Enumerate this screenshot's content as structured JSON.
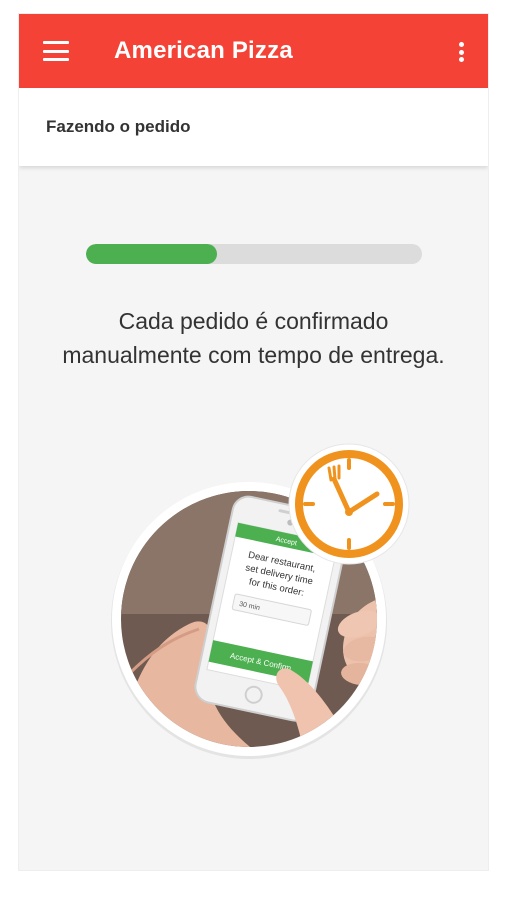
{
  "app_bar": {
    "title": "American Pizza",
    "menu_icon": "hamburger-menu-icon",
    "more_icon": "more-vertical-icon",
    "color": "#f44336"
  },
  "subheader": {
    "title": "Fazendo o pedido"
  },
  "progress": {
    "value_fraction": 0.39,
    "track_color": "#dcdcdc",
    "fill_color": "#4caf50"
  },
  "message": {
    "line1": "Cada pedido é confirmado",
    "line2": "manualmente com tempo de entrega."
  },
  "illustration": {
    "phone_header": "Accept",
    "phone_text_line1": "Dear restaurant,",
    "phone_text_line2": "set delivery time",
    "phone_text_line3": "for this order:",
    "phone_input_value": "30 min",
    "phone_button": "Accept & Confirm",
    "clock_icon": "clock-fork-icon",
    "clock_color": "#f0931e"
  }
}
